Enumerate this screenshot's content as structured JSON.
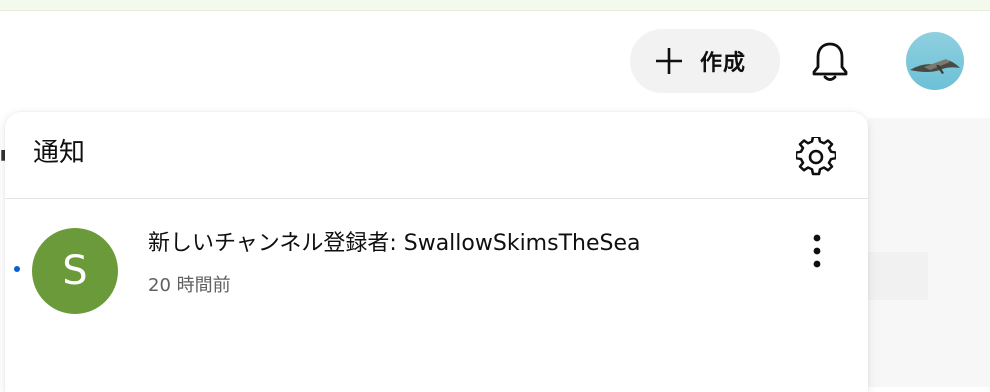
{
  "header": {
    "create_label": "作成",
    "create_icon": "plus-icon",
    "notifications_icon": "bell-icon",
    "avatar_icon": "user-avatar"
  },
  "notifications_panel": {
    "title": "通知",
    "settings_icon": "gear-icon",
    "items": [
      {
        "avatar_letter": "S",
        "avatar_color": "#6a9a3a",
        "message": "新しいチャンネル登録者: SwallowSkimsTheSea",
        "time": "20 時間前",
        "unread": true,
        "menu_icon": "more-vertical-icon"
      }
    ]
  },
  "colors": {
    "unread_dot": "#065fd4",
    "create_button_bg": "#f2f2f2"
  }
}
